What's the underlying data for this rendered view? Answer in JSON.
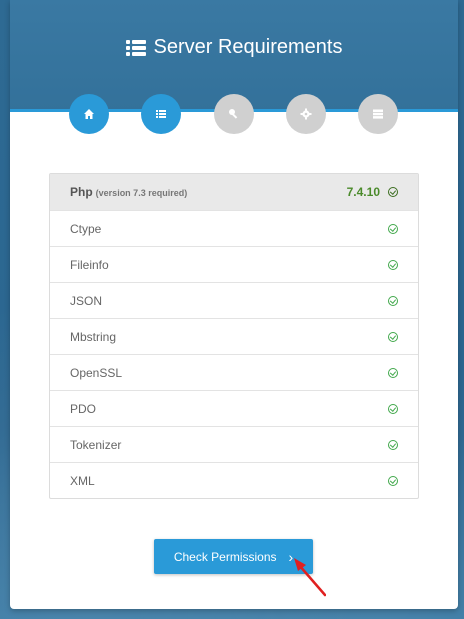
{
  "header": {
    "title": "Server Requirements",
    "title_icon": "list-icon"
  },
  "steps": [
    {
      "icon": "home-icon",
      "state": "active"
    },
    {
      "icon": "list-icon",
      "state": "active"
    },
    {
      "icon": "key-icon",
      "state": "inactive"
    },
    {
      "icon": "gear-icon",
      "state": "inactive"
    },
    {
      "icon": "server-icon",
      "state": "inactive"
    }
  ],
  "requirements": {
    "php": {
      "name": "Php",
      "note": "(version 7.3 required)",
      "version": "7.4.10",
      "status": "ok"
    },
    "extensions": [
      {
        "name": "Ctype",
        "status": "ok"
      },
      {
        "name": "Fileinfo",
        "status": "ok"
      },
      {
        "name": "JSON",
        "status": "ok"
      },
      {
        "name": "Mbstring",
        "status": "ok"
      },
      {
        "name": "OpenSSL",
        "status": "ok"
      },
      {
        "name": "PDO",
        "status": "ok"
      },
      {
        "name": "Tokenizer",
        "status": "ok"
      },
      {
        "name": "XML",
        "status": "ok"
      }
    ]
  },
  "action": {
    "label": "Check Permissions",
    "chevron": "›"
  },
  "colors": {
    "accent": "#2a9ad8",
    "header": "#3a79a3",
    "ok": "#41a84b",
    "annotation_arrow": "#e02020"
  }
}
